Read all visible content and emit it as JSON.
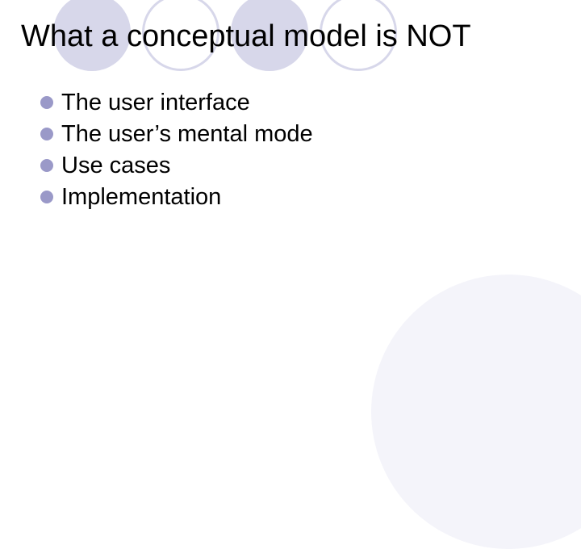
{
  "title": "What a conceptual model is NOT",
  "bullets": [
    "The user interface",
    "The user’s mental mode",
    "Use cases",
    "Implementation"
  ]
}
